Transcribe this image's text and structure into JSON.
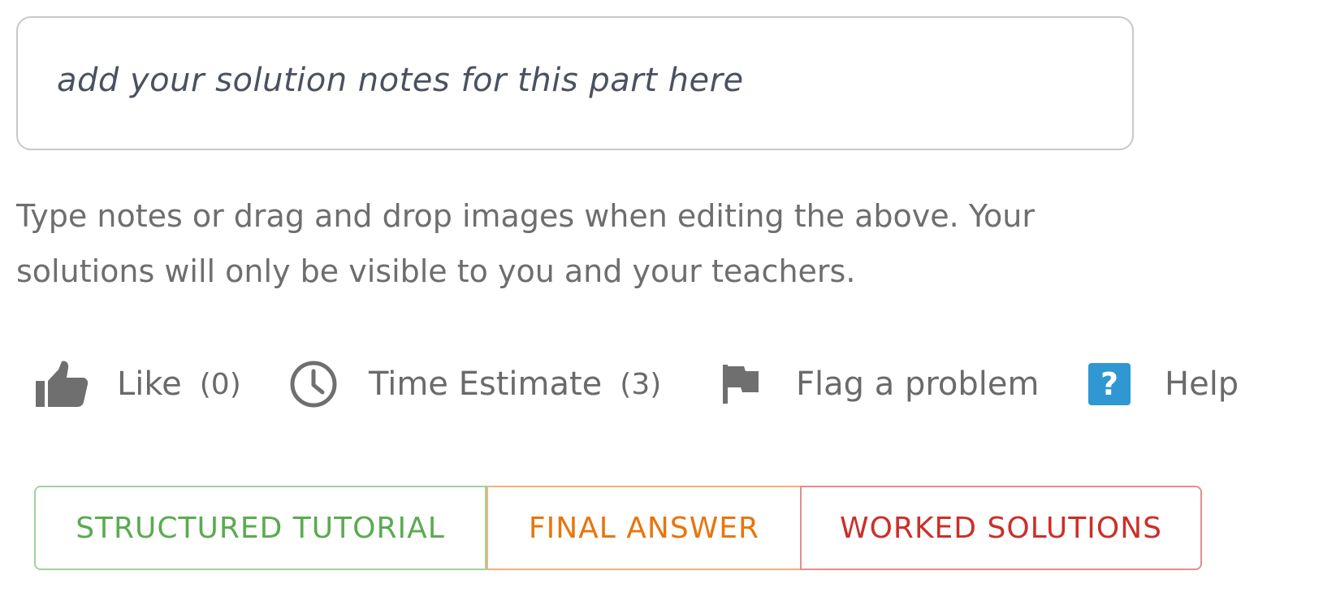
{
  "notes": {
    "placeholder": "add your solution notes for this part here"
  },
  "hint": {
    "line1": "Type notes or drag and drop images when editing the above. Your",
    "line2": "solutions will only be visible to you and your teachers."
  },
  "actions": {
    "like": {
      "label": "Like",
      "count": "(0)",
      "icon": "thumbs-up-icon"
    },
    "time_estimate": {
      "label": "Time Estimate",
      "count": "(3)",
      "icon": "clock-icon"
    },
    "flag": {
      "label": "Flag a problem",
      "icon": "flag-icon"
    },
    "help": {
      "label": "Help",
      "icon_glyph": "?",
      "icon": "help-icon"
    }
  },
  "tabs": [
    {
      "label": "STRUCTURED TUTORIAL",
      "color": "#5aab50"
    },
    {
      "label": "FINAL ANSWER",
      "color": "#e8750e"
    },
    {
      "label": "WORKED SOLUTIONS",
      "color": "#cc2f2a"
    }
  ],
  "colors": {
    "icon_gray": "#6f6f6f",
    "help_blue": "#2f97d2",
    "text_gray": "#6a6a6a"
  }
}
